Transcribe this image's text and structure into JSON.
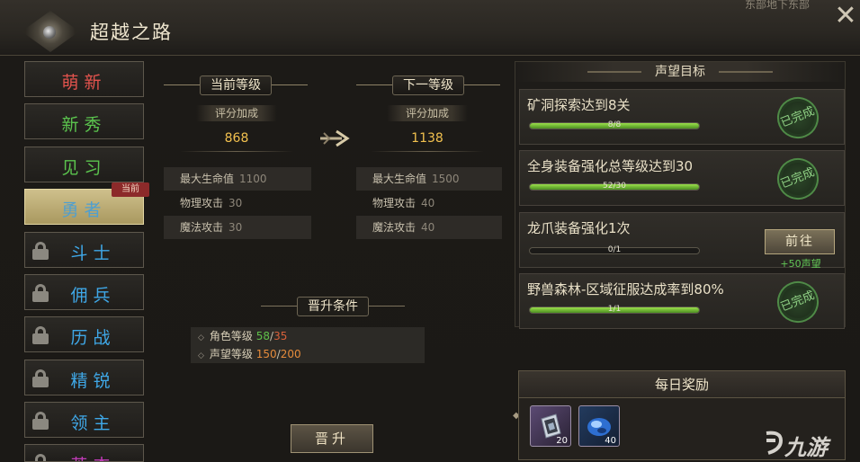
{
  "window": {
    "title": "超越之路",
    "topright_text": "东部地下东部",
    "close_glyph": "✕"
  },
  "sidebar": {
    "current_tag": "当前",
    "items": [
      {
        "label": "萌新",
        "color": "#e2534d",
        "locked": false
      },
      {
        "label": "新秀",
        "color": "#5bc44e",
        "locked": false
      },
      {
        "label": "见习",
        "color": "#5bc44e",
        "locked": false
      },
      {
        "label": "勇者",
        "color": "#5aaee0",
        "locked": false,
        "active": true
      },
      {
        "label": "斗士",
        "color": "#3fa8e8",
        "locked": true
      },
      {
        "label": "佣兵",
        "color": "#3fa8e8",
        "locked": true
      },
      {
        "label": "历战",
        "color": "#3fa8e8",
        "locked": true
      },
      {
        "label": "精锐",
        "color": "#3fa8e8",
        "locked": true
      },
      {
        "label": "领主",
        "color": "#3fa8e8",
        "locked": true
      },
      {
        "label": "英杰",
        "color": "#c03bb7",
        "locked": true
      }
    ]
  },
  "current_level": {
    "header": "当前等级",
    "score_label": "评分加成",
    "score_value": "868",
    "stats": [
      {
        "name": "最大生命值",
        "value": "1100"
      },
      {
        "name": "物理攻击",
        "value": "30"
      },
      {
        "name": "魔法攻击",
        "value": "30"
      }
    ]
  },
  "next_level": {
    "header": "下一等级",
    "score_label": "评分加成",
    "score_value": "1138",
    "stats": [
      {
        "name": "最大生命值",
        "value": "1500"
      },
      {
        "name": "物理攻击",
        "value": "40"
      },
      {
        "name": "魔法攻击",
        "value": "40"
      }
    ]
  },
  "conditions": {
    "header": "晋升条件",
    "items": [
      {
        "name": "角色等级",
        "have": "58",
        "need": "35"
      },
      {
        "name": "声望等级",
        "have": "150",
        "need": "200"
      }
    ]
  },
  "promote_button": "晋升",
  "reputation": {
    "header": "声望目标",
    "goals": [
      {
        "title": "矿洞探索达到8关",
        "progress_text": "8/8",
        "progress": 1.0,
        "status": "已完成"
      },
      {
        "title": "全身装备强化总等级达到30",
        "progress_text": "52/30",
        "progress": 1.0,
        "status": "已完成"
      },
      {
        "title": "龙爪装备强化1次",
        "progress_text": "0/1",
        "progress": 0.0,
        "goto_label": "前往",
        "reward": "+50声望"
      },
      {
        "title": "野兽森林-区域征服达成率到80%",
        "progress_text": "1/1",
        "progress": 1.0,
        "status": "已完成"
      }
    ]
  },
  "daily": {
    "header": "每日奖励",
    "rewards": [
      {
        "icon": "crystal-card-icon",
        "count": "20"
      },
      {
        "icon": "blue-gem-icon",
        "count": "40"
      }
    ]
  },
  "watermark": "九游"
}
